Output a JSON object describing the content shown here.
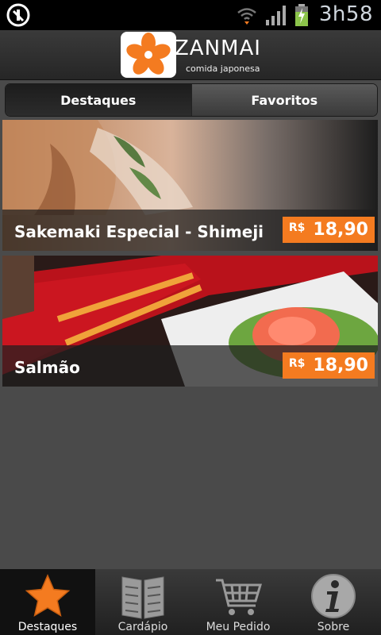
{
  "statusbar": {
    "time": "3h58"
  },
  "header": {
    "brand": "ZANMAI",
    "tagline": "comida japonesa"
  },
  "tabs": [
    {
      "label": "Destaques",
      "active": true
    },
    {
      "label": "Favoritos",
      "active": false
    }
  ],
  "items": [
    {
      "title": "Sakemaki Especial - Shimeji",
      "currency": "R$",
      "price": "18,90"
    },
    {
      "title": "Salmão",
      "currency": "R$",
      "price": "18,90"
    }
  ],
  "nav": [
    {
      "label": "Destaques",
      "icon": "star-icon",
      "active": true
    },
    {
      "label": "Cardápio",
      "icon": "menu-book-icon",
      "active": false
    },
    {
      "label": "Meu Pedido",
      "icon": "cart-icon",
      "active": false
    },
    {
      "label": "Sobre",
      "icon": "info-icon",
      "active": false
    }
  ],
  "colors": {
    "accent": "#f47b20",
    "background": "#4a4a4a",
    "header": "#2b2b2b"
  }
}
